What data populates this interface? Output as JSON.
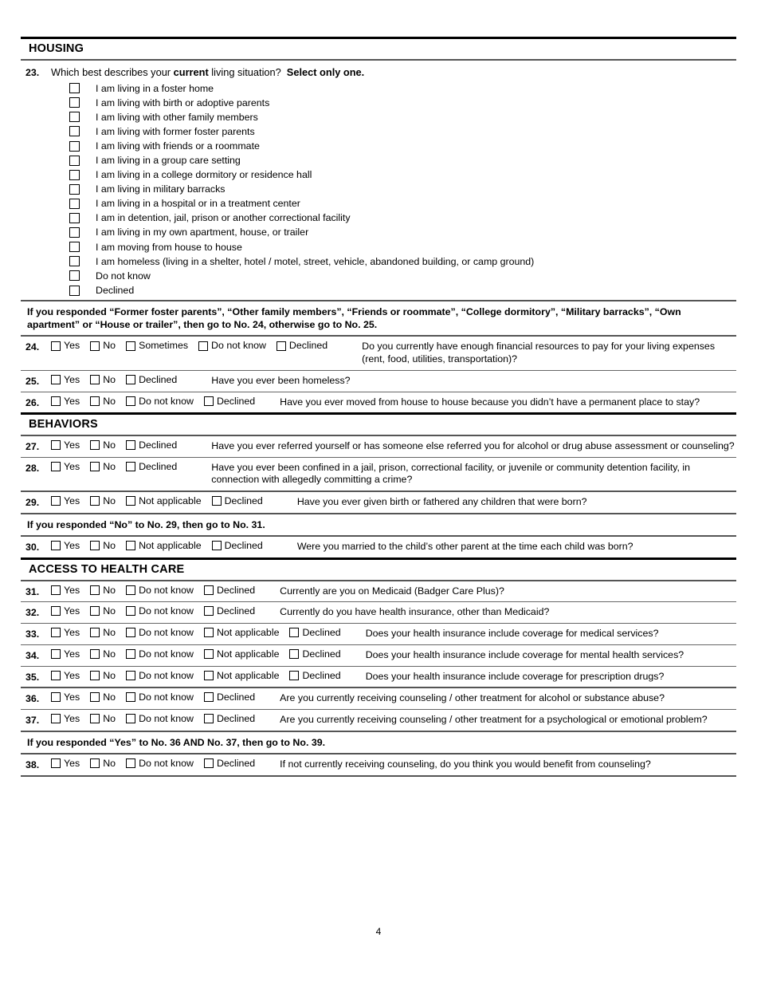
{
  "page": {
    "number": "4"
  },
  "sections": [
    {
      "id": "housing",
      "title": "HOUSING"
    },
    {
      "id": "behaviors",
      "title": "BEHAVIORS"
    },
    {
      "id": "access",
      "title": "ACCESS TO HEALTH CARE"
    }
  ],
  "q23": {
    "number": "23.",
    "text_a": "Which best describes your ",
    "text_bold_1": "current",
    "text_b": " living situation?",
    "text_bold_2": "Select only one.",
    "options": [
      "I am living in a foster home",
      "I am living with birth or adoptive parents",
      "I am living with other family members",
      "I am living with former foster parents",
      "I am living with friends or a roommate",
      "I am living in a group care setting",
      "I am living in a college dormitory or residence hall",
      "I am living in military barracks",
      "I am living in a hospital or in a treatment center",
      "I am in detention, jail, prison or another correctional facility",
      "I am living in my own apartment, house, or trailer",
      "I am moving from house to house",
      "I am homeless (living in a shelter, hotel / motel, street, vehicle, abandoned building, or camp ground)",
      "Do not know",
      "Declined"
    ]
  },
  "instruction_1": "If you responded “Former foster parents”, “Other family members”, “Friends or roommate”, “College dormitory”, “Military barracks”, “Own apartment” or “House or trailer”, then go to No. 24, otherwise go to No. 25.",
  "instruction_2": "If you responded “No” to No. 29, then go to No. 31.",
  "instruction_3": "If you responded “Yes” to No. 36 AND No. 37, then go to No. 39.",
  "questions": [
    {
      "number": "24.",
      "options": [
        "Yes",
        "No",
        "Sometimes",
        "Do not know",
        "Declined"
      ],
      "text": "Do you currently have enough financial resources to pay for your living expenses (rent, food, utilities, transportation)?"
    },
    {
      "number": "25.",
      "options": [
        "Yes",
        "No",
        "Declined"
      ],
      "text": "Have you ever been homeless?"
    },
    {
      "number": "26.",
      "options": [
        "Yes",
        "No",
        "Do not know",
        "Declined"
      ],
      "text": "Have you ever moved from house to house because you didn’t have a permanent place to stay?"
    },
    {
      "number": "27.",
      "options": [
        "Yes",
        "No",
        "Declined"
      ],
      "text": "Have you ever referred yourself or has someone else referred you for alcohol or drug abuse assessment or counseling?"
    },
    {
      "number": "28.",
      "options": [
        "Yes",
        "No",
        "Declined"
      ],
      "text": "Have you ever been confined in a jail, prison, correctional facility, or juvenile or community detention facility, in connection with allegedly committing a crime?"
    },
    {
      "number": "29.",
      "options": [
        "Yes",
        "No",
        "Not applicable",
        "Declined"
      ],
      "text": "Have you ever given birth or fathered any children that were born?"
    },
    {
      "number": "30.",
      "options": [
        "Yes",
        "No",
        "Not applicable",
        "Declined"
      ],
      "text": "Were you married to the child’s other parent at the time each child was born?"
    },
    {
      "number": "31.",
      "options": [
        "Yes",
        "No",
        "Do not know",
        "Declined"
      ],
      "text": "Currently are you on Medicaid (Badger Care Plus)?"
    },
    {
      "number": "32.",
      "options": [
        "Yes",
        "No",
        "Do not know",
        "Declined"
      ],
      "text": "Currently do you have health insurance, other than Medicaid?"
    },
    {
      "number": "33.",
      "options": [
        "Yes",
        "No",
        "Do not know",
        "Not applicable",
        "Declined"
      ],
      "text": "Does your health insurance include coverage for medical services?"
    },
    {
      "number": "34.",
      "options": [
        "Yes",
        "No",
        "Do not know",
        "Not applicable",
        "Declined"
      ],
      "text": "Does your health insurance include coverage for mental health services?"
    },
    {
      "number": "35.",
      "options": [
        "Yes",
        "No",
        "Do not know",
        "Not applicable",
        "Declined"
      ],
      "text": "Does your health insurance include coverage for prescription drugs?"
    },
    {
      "number": "36.",
      "options": [
        "Yes",
        "No",
        "Do not know",
        "Declined"
      ],
      "text": "Are you currently receiving counseling / other treatment for alcohol or substance abuse?"
    },
    {
      "number": "37.",
      "options": [
        "Yes",
        "No",
        "Do not know",
        "Declined"
      ],
      "text": "Are you currently receiving counseling / other treatment for a psychological or emotional problem?"
    },
    {
      "number": "38.",
      "options": [
        "Yes",
        "No",
        "Do not know",
        "Declined"
      ],
      "text": "If not currently receiving counseling, do you think you would benefit from counseling?"
    }
  ]
}
